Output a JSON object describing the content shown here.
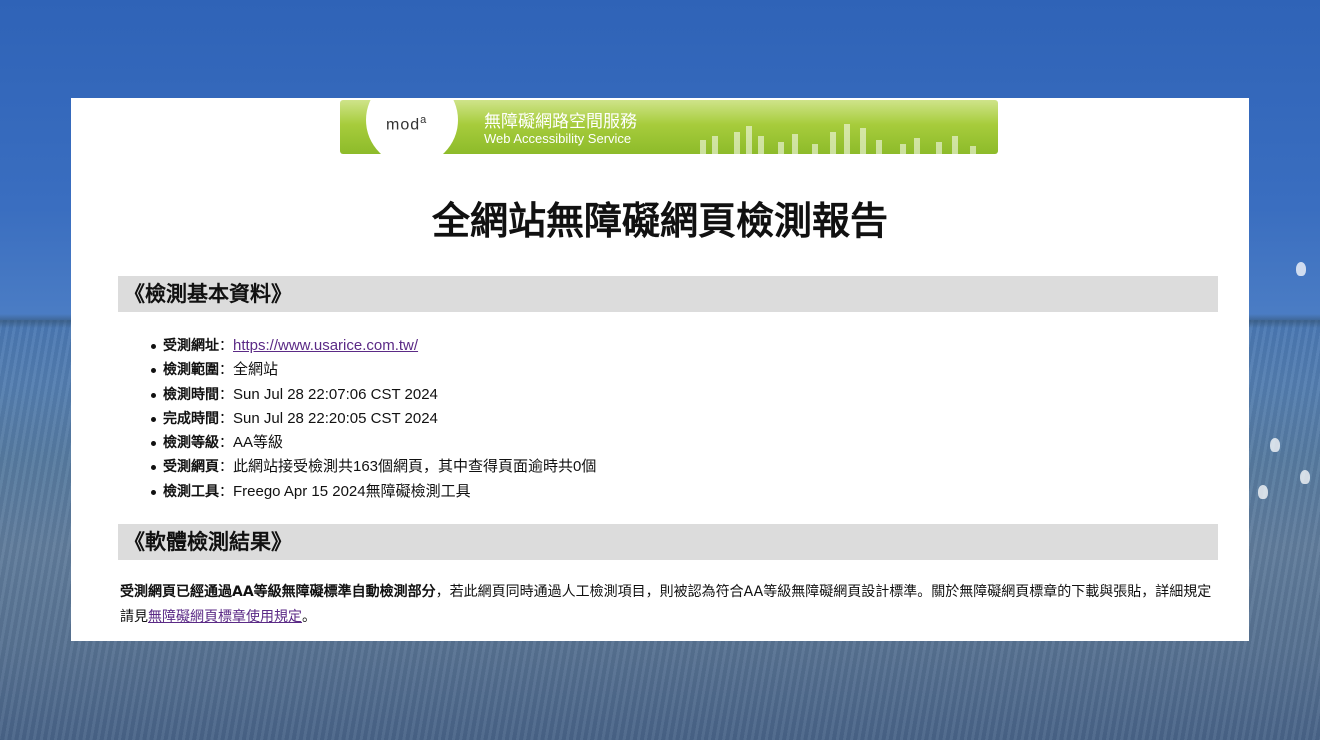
{
  "banner": {
    "logo": "mod",
    "logo_sup": "a",
    "title_zh": "無障礙網路空間服務",
    "title_en": "Web Accessibility Service"
  },
  "report": {
    "title": "全網站無障礙網頁檢測報告"
  },
  "section_basic": {
    "heading": "《檢測基本資料》",
    "items": [
      {
        "key": "受測網址",
        "sep": "：",
        "value": "https://www.usarice.com.tw/",
        "is_link": true
      },
      {
        "key": "檢測範圍",
        "sep": "：",
        "value": "全網站"
      },
      {
        "key": "檢測時間",
        "sep": "：",
        "value": "Sun Jul 28 22:07:06 CST 2024"
      },
      {
        "key": "完成時間",
        "sep": "：",
        "value": "Sun Jul 28 22:20:05 CST 2024"
      },
      {
        "key": "檢測等級",
        "sep": "：",
        "value": "AA等級"
      },
      {
        "key": "受測網頁",
        "sep": "：",
        "value": "此網站接受檢測共163個網頁，其中查得頁面逾時共0個"
      },
      {
        "key": "檢測工具",
        "sep": "：",
        "value": "Freego Apr 15 2024無障礙檢測工具"
      }
    ]
  },
  "section_result": {
    "heading": "《軟體檢測結果》",
    "bold_text": "受測網頁已經通過AA等級無障礙標準自動檢測部分",
    "text_1": "，若此網頁同時通過人工檢測項目，則被認為符合AA等級無障礙網頁設計標準。關於無障礙網頁標章的下載與張貼，詳細規定請見",
    "link_text": "無障礙網頁標章使用規定",
    "text_2": "。"
  },
  "colors": {
    "link": "#5b2a86",
    "section_bg": "#dcdcdc",
    "banner_green": "#a7cc3c"
  }
}
